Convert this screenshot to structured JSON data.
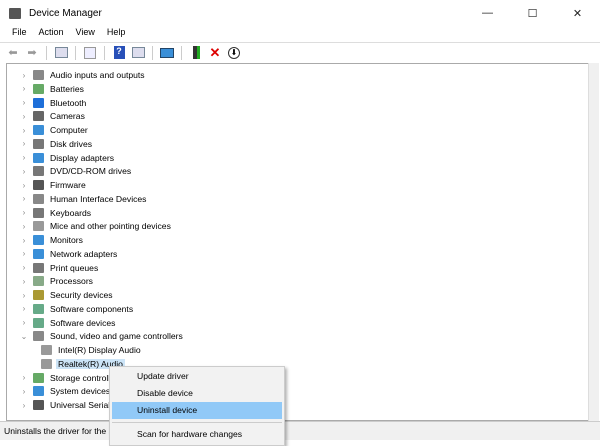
{
  "window": {
    "title": "Device Manager",
    "min": "—",
    "max": "☐",
    "close": "✕"
  },
  "menu": [
    "File",
    "Action",
    "View",
    "Help"
  ],
  "toolbar": [
    "back-icon",
    "forward-icon",
    "properties-icon",
    "refresh-icon",
    "help-icon",
    "show-hidden-icon",
    "scan-icon",
    "update-driver-icon",
    "uninstall-icon",
    "download-icon"
  ],
  "tree": [
    {
      "label": "Audio inputs and outputs",
      "color": "#888"
    },
    {
      "label": "Batteries",
      "color": "#6a6"
    },
    {
      "label": "Bluetooth",
      "color": "#1e6fd9"
    },
    {
      "label": "Cameras",
      "color": "#666"
    },
    {
      "label": "Computer",
      "color": "#3a8fd8"
    },
    {
      "label": "Disk drives",
      "color": "#777"
    },
    {
      "label": "Display adapters",
      "color": "#3a8fd8"
    },
    {
      "label": "DVD/CD-ROM drives",
      "color": "#777"
    },
    {
      "label": "Firmware",
      "color": "#555"
    },
    {
      "label": "Human Interface Devices",
      "color": "#888"
    },
    {
      "label": "Keyboards",
      "color": "#777"
    },
    {
      "label": "Mice and other pointing devices",
      "color": "#999"
    },
    {
      "label": "Monitors",
      "color": "#3a8fd8"
    },
    {
      "label": "Network adapters",
      "color": "#3a8fd8"
    },
    {
      "label": "Print queues",
      "color": "#777"
    },
    {
      "label": "Processors",
      "color": "#8a8"
    },
    {
      "label": "Security devices",
      "color": "#a93"
    },
    {
      "label": "Software components",
      "color": "#6a8"
    },
    {
      "label": "Software devices",
      "color": "#6a8"
    },
    {
      "label": "Sound, video and game controllers",
      "color": "#888",
      "expanded": true
    },
    {
      "label": "Intel(R) Display Audio",
      "color": "#999",
      "child": true
    },
    {
      "label": "Realtek(R) Audio",
      "color": "#999",
      "child": true,
      "selected": true
    },
    {
      "label": "Storage controllers",
      "color": "#6a6"
    },
    {
      "label": "System devices",
      "color": "#3a8fd8"
    },
    {
      "label": "Universal Serial Bus controllers",
      "color": "#555"
    }
  ],
  "context_menu": [
    {
      "label": "Update driver"
    },
    {
      "label": "Disable device"
    },
    {
      "label": "Uninstall device",
      "highlighted": true
    },
    {
      "label": "Scan for hardware changes",
      "separator_before": true
    }
  ],
  "status": "Uninstalls the driver for the selected device."
}
